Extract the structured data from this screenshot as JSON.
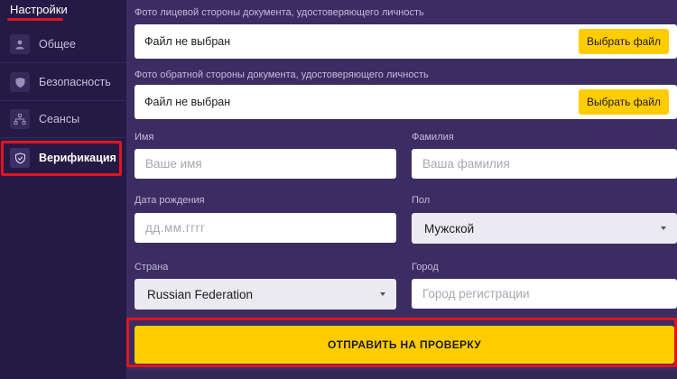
{
  "sidebar": {
    "title": "Настройки",
    "items": [
      {
        "label": "Общее",
        "icon": "user-icon"
      },
      {
        "label": "Безопасность",
        "icon": "shield-icon"
      },
      {
        "label": "Сеансы",
        "icon": "sessions-icon"
      },
      {
        "label": "Верификация",
        "icon": "shield-check-icon",
        "active": true
      }
    ]
  },
  "form": {
    "front_photo": {
      "label": "Фото лицевой стороны документа, удостоверяющего личность",
      "status": "Файл не выбран",
      "button": "Выбрать файл"
    },
    "back_photo": {
      "label": "Фото обратной стороны документа, удостоверяющего личность",
      "status": "Файл не выбран",
      "button": "Выбрать файл"
    },
    "first_name": {
      "label": "Имя",
      "placeholder": "Ваше имя"
    },
    "last_name": {
      "label": "Фамилия",
      "placeholder": "Ваша фамилия"
    },
    "birth_date": {
      "label": "Дата рождения",
      "placeholder": "дд.мм.гггг"
    },
    "gender": {
      "label": "Пол",
      "value": "Мужской"
    },
    "country": {
      "label": "Страна",
      "value": "Russian Federation"
    },
    "city": {
      "label": "Город",
      "placeholder": "Город регистрации"
    },
    "submit": "ОТПРАВИТЬ НА ПРОВЕРКУ"
  },
  "colors": {
    "accent": "#ffcc00",
    "highlight": "#e0151f",
    "sidebar_bg": "#241a45",
    "main_bg": "#3b2d62"
  }
}
